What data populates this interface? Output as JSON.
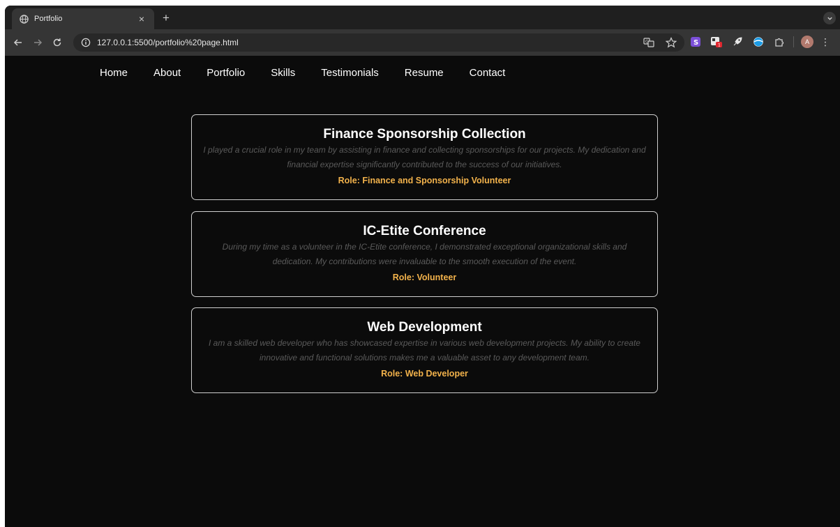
{
  "browser": {
    "tab_title": "Portfolio",
    "tab_close": "×",
    "new_tab": "+",
    "url": "127.0.0.1:5500/portfolio%20page.html",
    "avatar_letter": "A",
    "extension_badge": "1"
  },
  "nav": [
    "Home",
    "About",
    "Portfolio",
    "Skills",
    "Testimonials",
    "Resume",
    "Contact"
  ],
  "cards": [
    {
      "title": "Finance Sponsorship Collection",
      "description": "I played a crucial role in my team by assisting in finance and collecting sponsorships for our projects. My dedication and financial expertise significantly contributed to the success of our initiatives.",
      "role": "Role: Finance and Sponsorship Volunteer"
    },
    {
      "title": "IC-Etite Conference",
      "description": "During my time as a volunteer in the IC-Etite conference, I demonstrated exceptional organizational skills and dedication. My contributions were invaluable to the smooth execution of the event.",
      "role": "Role: Volunteer"
    },
    {
      "title": "Web Development",
      "description": "I am a skilled web developer who has showcased expertise in various web development projects. My ability to create innovative and functional solutions makes me a valuable asset to any development team.",
      "role": "Role: Web Developer"
    }
  ],
  "colors": {
    "page_bg": "#0b0b0b",
    "role_accent": "#f2b24b",
    "description_text": "#5a5a5a",
    "card_border": "#cfcfcf"
  }
}
